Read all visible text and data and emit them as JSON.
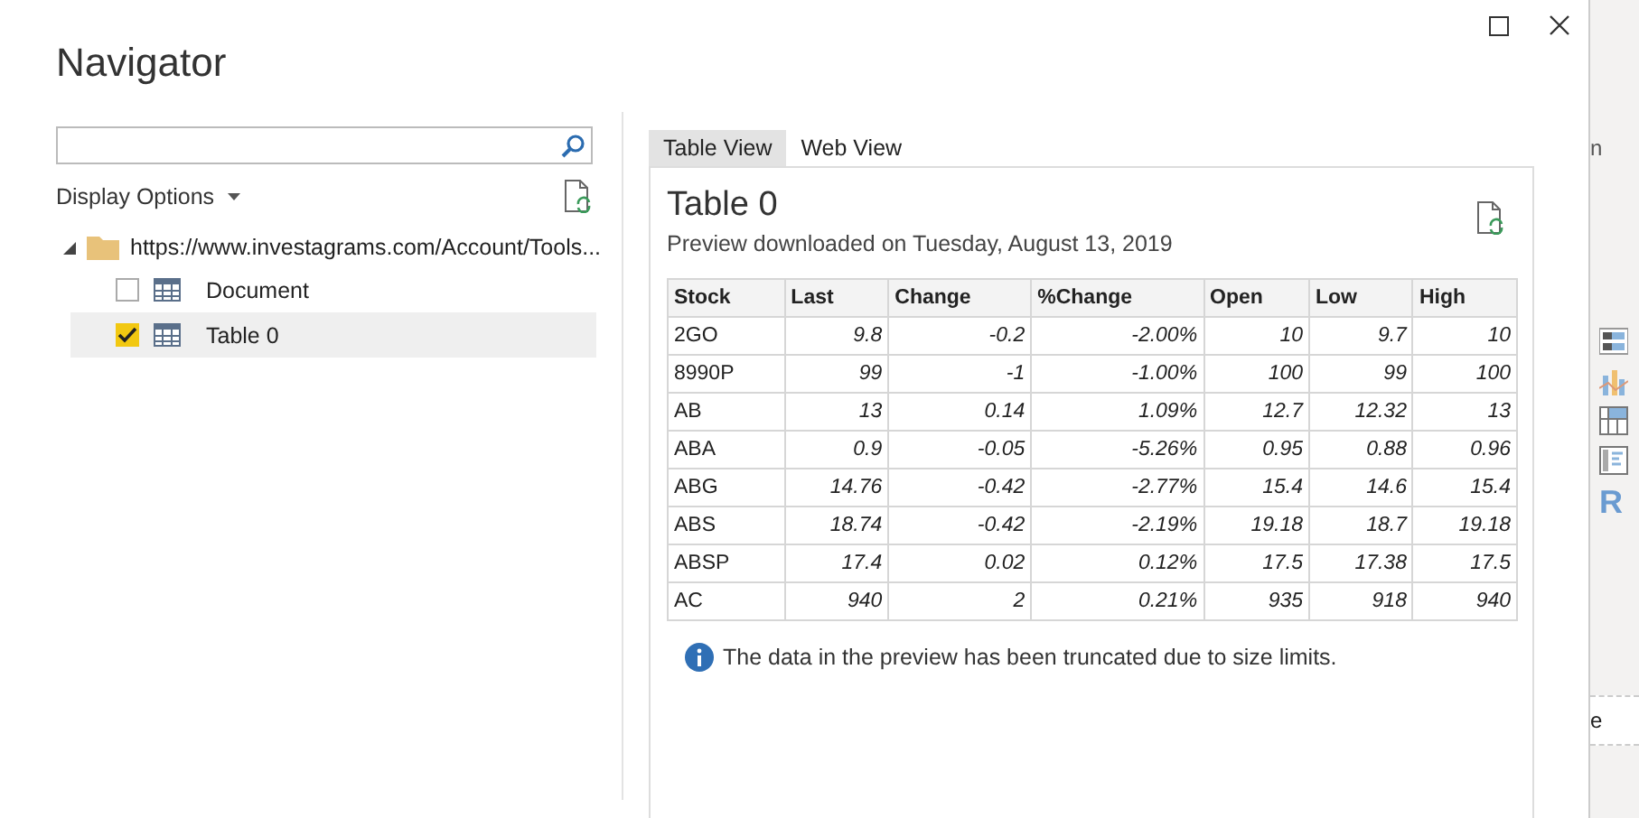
{
  "window": {
    "title": "Navigator"
  },
  "display_options": {
    "label": "Display Options"
  },
  "tree": {
    "label": "https://www.investagrams.com/Account/Tools...",
    "expanded": true,
    "children": [
      {
        "label": "Document",
        "checked": false,
        "selected": false
      },
      {
        "label": "Table 0",
        "checked": true,
        "selected": true
      }
    ]
  },
  "tabs": [
    {
      "label": "Table View",
      "selected": true
    },
    {
      "label": "Web View",
      "selected": false
    }
  ],
  "preview": {
    "title": "Table 0",
    "subtitle": "Preview downloaded on Tuesday, August 13, 2019",
    "columns": [
      "Stock",
      "Last",
      "Change",
      "%Change",
      "Open",
      "Low",
      "High"
    ],
    "rows": [
      [
        "2GO",
        "9.8",
        "-0.2",
        "-2.00%",
        "10",
        "9.7",
        "10"
      ],
      [
        "8990P",
        "99",
        "-1",
        "-1.00%",
        "100",
        "99",
        "100"
      ],
      [
        "AB",
        "13",
        "0.14",
        "1.09%",
        "12.7",
        "12.32",
        "13"
      ],
      [
        "ABA",
        "0.9",
        "-0.05",
        "-5.26%",
        "0.95",
        "0.88",
        "0.96"
      ],
      [
        "ABG",
        "14.76",
        "-0.42",
        "-2.77%",
        "15.4",
        "14.6",
        "15.4"
      ],
      [
        "ABS",
        "18.74",
        "-0.42",
        "-2.19%",
        "19.18",
        "18.7",
        "19.18"
      ],
      [
        "ABSP",
        "17.4",
        "0.02",
        "0.12%",
        "17.5",
        "17.38",
        "17.5"
      ],
      [
        "AC",
        "940",
        "2",
        "0.21%",
        "935",
        "918",
        "940"
      ]
    ],
    "notice": "The data in the preview has been truncated due to size limits."
  },
  "background_app": {
    "text_fragments": [
      "n",
      "e"
    ],
    "letter_icon": "R"
  }
}
